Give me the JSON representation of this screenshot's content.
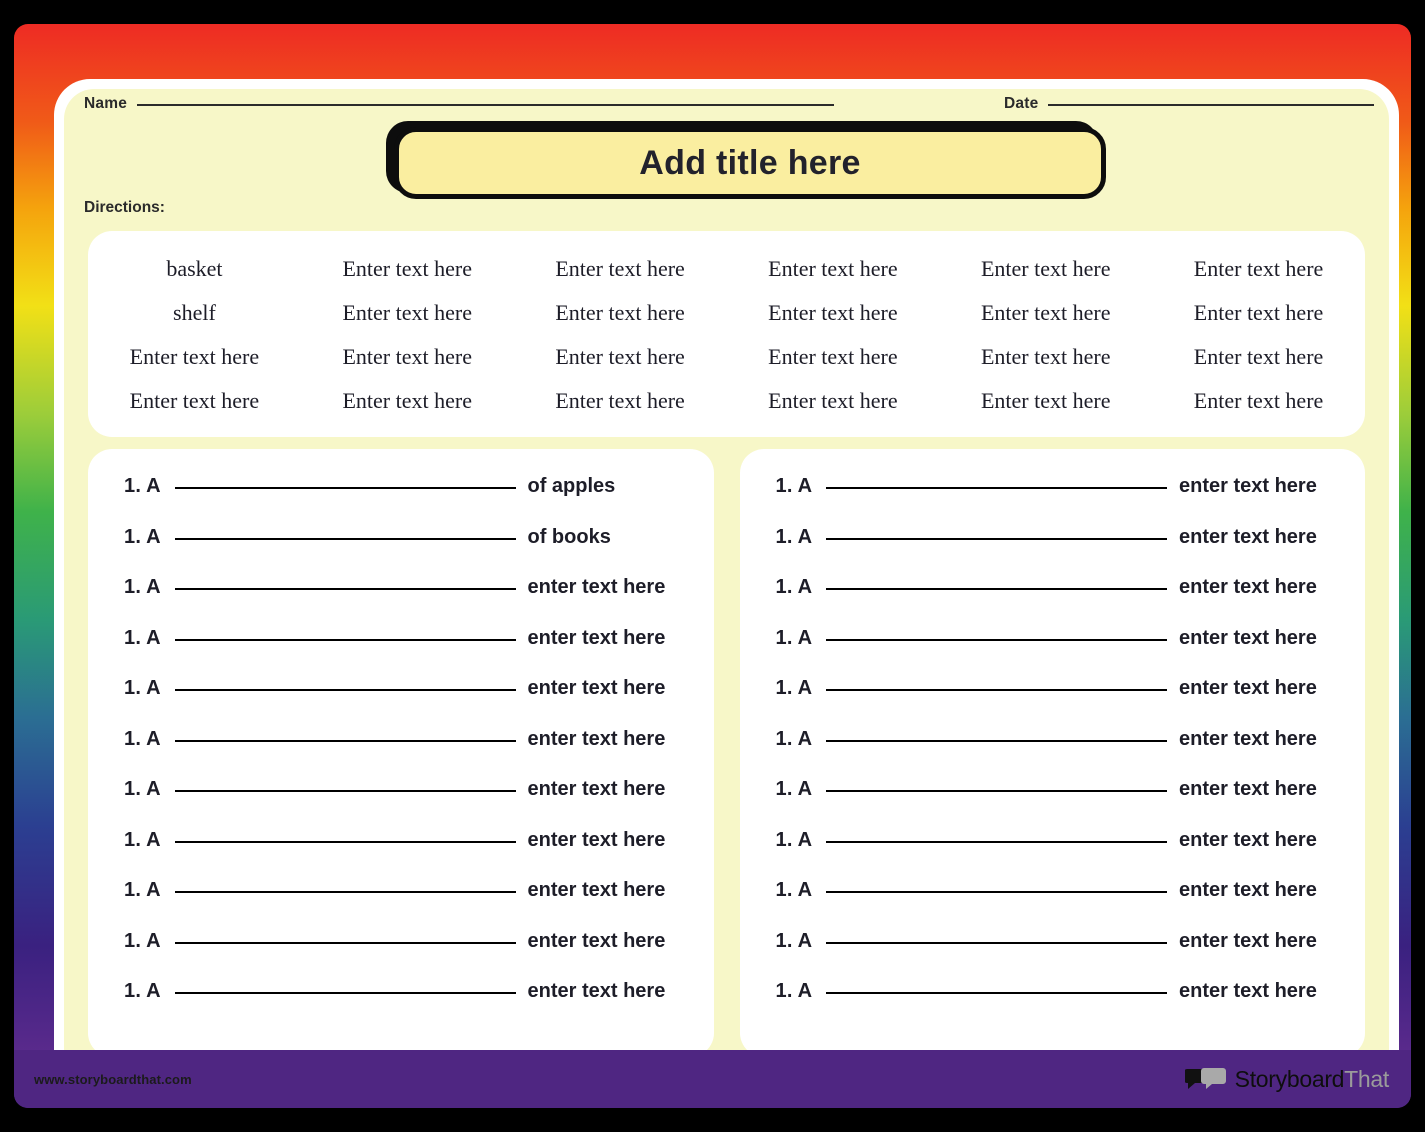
{
  "frame": {
    "rainbow_colors": [
      "#ee2b24",
      "#f05a18",
      "#f5a30d",
      "#f2e016",
      "#9ccd3a",
      "#3fb24a",
      "#2a9a76",
      "#2b6e93",
      "#2b3f91",
      "#3a2180",
      "#5e2d8f"
    ],
    "paper_color": "#f7f7c8",
    "card_color": "#ffffff",
    "footer_color": "#4f2682"
  },
  "header": {
    "name_label": "Name",
    "date_label": "Date"
  },
  "title": {
    "text": "Add title here",
    "fill_color": "#faeea0",
    "border_color": "#0d0d0d"
  },
  "directions": {
    "label": "Directions:"
  },
  "word_bank": {
    "columns": 6,
    "rows": [
      [
        "basket",
        "Enter text here",
        "Enter text here",
        "Enter text here",
        "Enter text here",
        "Enter text here"
      ],
      [
        "shelf",
        "Enter text here",
        "Enter text here",
        "Enter text here",
        "Enter text here",
        "Enter text here"
      ],
      [
        "Enter text here",
        "Enter text here",
        "Enter text here",
        "Enter text here",
        "Enter text here",
        "Enter text here"
      ],
      [
        "Enter text here",
        "Enter text here",
        "Enter text here",
        "Enter text here",
        "Enter text here",
        "Enter text here"
      ]
    ]
  },
  "questions": {
    "left_column": [
      {
        "prefix": "1. A",
        "suffix": "of apples"
      },
      {
        "prefix": "1. A",
        "suffix": "of books"
      },
      {
        "prefix": "1. A",
        "suffix": "enter text here"
      },
      {
        "prefix": "1. A",
        "suffix": "enter text here"
      },
      {
        "prefix": "1. A",
        "suffix": "enter text here"
      },
      {
        "prefix": "1. A",
        "suffix": "enter text here"
      },
      {
        "prefix": "1. A",
        "suffix": "enter text here"
      },
      {
        "prefix": "1. A",
        "suffix": "enter text here"
      },
      {
        "prefix": "1. A",
        "suffix": "enter text here"
      },
      {
        "prefix": "1. A",
        "suffix": "enter text here"
      },
      {
        "prefix": "1. A",
        "suffix": "enter text here"
      }
    ],
    "right_column": [
      {
        "prefix": "1. A",
        "suffix": "enter text here"
      },
      {
        "prefix": "1. A",
        "suffix": "enter text here"
      },
      {
        "prefix": "1. A",
        "suffix": "enter text here"
      },
      {
        "prefix": "1. A",
        "suffix": "enter text here"
      },
      {
        "prefix": "1. A",
        "suffix": "enter text here"
      },
      {
        "prefix": "1. A",
        "suffix": "enter text here"
      },
      {
        "prefix": "1. A",
        "suffix": "enter text here"
      },
      {
        "prefix": "1. A",
        "suffix": "enter text here"
      },
      {
        "prefix": "1. A",
        "suffix": "enter text here"
      },
      {
        "prefix": "1. A",
        "suffix": "enter text here"
      },
      {
        "prefix": "1. A",
        "suffix": "enter text here"
      }
    ]
  },
  "footer": {
    "url": "www.storyboardthat.com",
    "brand_primary": "Storyboard",
    "brand_secondary": "That",
    "brand_icon": "speech-bubbles-icon"
  }
}
